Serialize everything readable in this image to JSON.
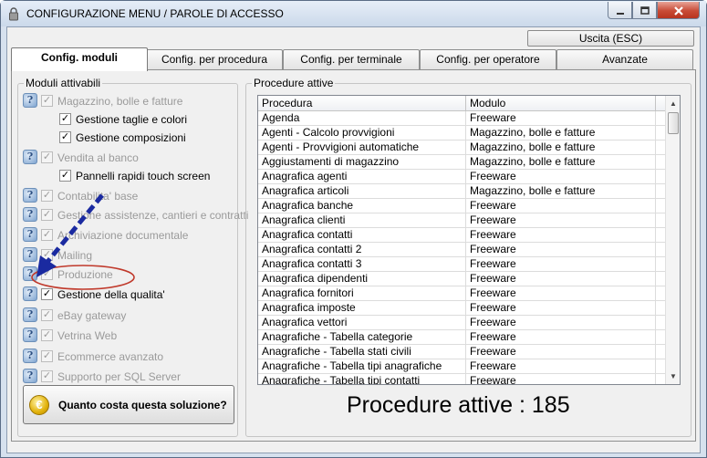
{
  "window": {
    "title": "CONFIGURAZIONE MENU / PAROLE DI ACCESSO"
  },
  "toolbar": {
    "exit_label": "Uscita (ESC)"
  },
  "tabs": [
    {
      "label": "Config. moduli",
      "active": true
    },
    {
      "label": "Config. per procedura"
    },
    {
      "label": "Config. per terminale"
    },
    {
      "label": "Config. per operatore"
    },
    {
      "label": "Avanzate"
    }
  ],
  "modules": {
    "group_title": "Moduli attivabili",
    "items": [
      {
        "label": "Magazzino, bolle e fatture",
        "checked": true,
        "enabled": false,
        "info": true,
        "indent": false
      },
      {
        "label": "Gestione taglie e colori",
        "checked": true,
        "enabled": true,
        "info": false,
        "indent": true
      },
      {
        "label": "Gestione composizioni",
        "checked": true,
        "enabled": true,
        "info": false,
        "indent": true
      },
      {
        "label": "Vendita al banco",
        "checked": true,
        "enabled": false,
        "info": true,
        "indent": false
      },
      {
        "label": "Pannelli rapidi touch screen",
        "checked": true,
        "enabled": true,
        "info": false,
        "indent": true
      },
      {
        "label": "Contabilita' base",
        "checked": true,
        "enabled": false,
        "info": true,
        "indent": false
      },
      {
        "label": "Gestione assistenze, cantieri e contratti",
        "checked": true,
        "enabled": false,
        "info": true,
        "indent": false
      },
      {
        "label": "Archiviazione documentale",
        "checked": true,
        "enabled": false,
        "info": true,
        "indent": false
      },
      {
        "label": "Mailing",
        "checked": true,
        "enabled": false,
        "info": true,
        "indent": false
      },
      {
        "label": "Produzione",
        "checked": true,
        "enabled": false,
        "info": true,
        "indent": false
      },
      {
        "label": "Gestione della qualita'",
        "checked": true,
        "enabled": true,
        "info": true,
        "indent": false
      },
      {
        "label": "eBay gateway",
        "checked": true,
        "enabled": false,
        "info": true,
        "indent": false
      },
      {
        "label": "Vetrina Web",
        "checked": true,
        "enabled": false,
        "info": true,
        "indent": false
      },
      {
        "label": "Ecommerce avanzato",
        "checked": true,
        "enabled": false,
        "info": true,
        "indent": false
      },
      {
        "label": "Supporto per SQL Server",
        "checked": true,
        "enabled": false,
        "info": true,
        "indent": false
      }
    ],
    "cost_button_label": "Quanto costa questa soluzione?"
  },
  "procedures": {
    "group_title": "Procedure attive",
    "columns": [
      "Procedura",
      "Modulo"
    ],
    "rows": [
      [
        "Agenda",
        "Freeware"
      ],
      [
        "Agenti - Calcolo provvigioni",
        "Magazzino, bolle e fatture"
      ],
      [
        "Agenti - Provvigioni automatiche",
        "Magazzino, bolle e fatture"
      ],
      [
        "Aggiustamenti di magazzino",
        "Magazzino, bolle e fatture"
      ],
      [
        "Anagrafica agenti",
        "Freeware"
      ],
      [
        "Anagrafica articoli",
        "Magazzino, bolle e fatture"
      ],
      [
        "Anagrafica banche",
        "Freeware"
      ],
      [
        "Anagrafica clienti",
        "Freeware"
      ],
      [
        "Anagrafica contatti",
        "Freeware"
      ],
      [
        "Anagrafica contatti 2",
        "Freeware"
      ],
      [
        "Anagrafica contatti 3",
        "Freeware"
      ],
      [
        "Anagrafica dipendenti",
        "Freeware"
      ],
      [
        "Anagrafica fornitori",
        "Freeware"
      ],
      [
        "Anagrafica imposte",
        "Freeware"
      ],
      [
        "Anagrafica vettori",
        "Freeware"
      ],
      [
        "Anagrafiche - Tabella categorie",
        "Freeware"
      ],
      [
        "Anagrafiche - Tabella stati civili",
        "Freeware"
      ],
      [
        "Anagrafiche - Tabella tipi anagrafiche",
        "Freeware"
      ],
      [
        "Anagrafiche - Tabella tipi contatti",
        "Freeware"
      ]
    ],
    "count_label": "Procedure attive : 185"
  },
  "colors": {
    "annotation_arrow": "#1a2aa0",
    "annotation_circle": "#c0392b"
  }
}
